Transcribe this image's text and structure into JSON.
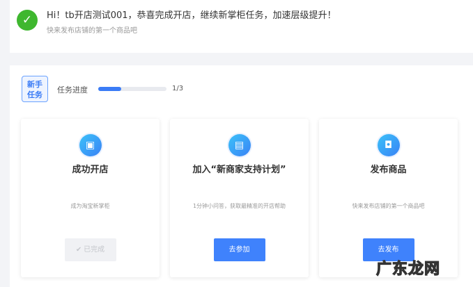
{
  "notice": {
    "title": "Hi！tb开店测试001，恭喜完成开店，继续新掌柜任务，加速层级提升！",
    "subtitle": "快来发布店铺的第一个商品吧"
  },
  "progress": {
    "badge_line1": "新手",
    "badge_line2": "任务",
    "label": "任务进度",
    "text": "1/3",
    "fraction": 0.333
  },
  "cards": [
    {
      "title": "成功开店",
      "desc": "成为淘宝新掌柜",
      "button": "✔ 已完成",
      "icon": "store-icon"
    },
    {
      "title": "加入“新商家支持计划”",
      "desc": "1分钟小问答，获取最精准的开店帮助",
      "button": "去参加",
      "icon": "calendar-icon"
    },
    {
      "title": "发布商品",
      "desc": "快来发布店铺的第一个商品吧",
      "button": "去发布",
      "icon": "bag-icon"
    }
  ],
  "watermark": "广东龙网",
  "colors": {
    "accent": "#3f82fc",
    "success": "#3fb72f"
  }
}
